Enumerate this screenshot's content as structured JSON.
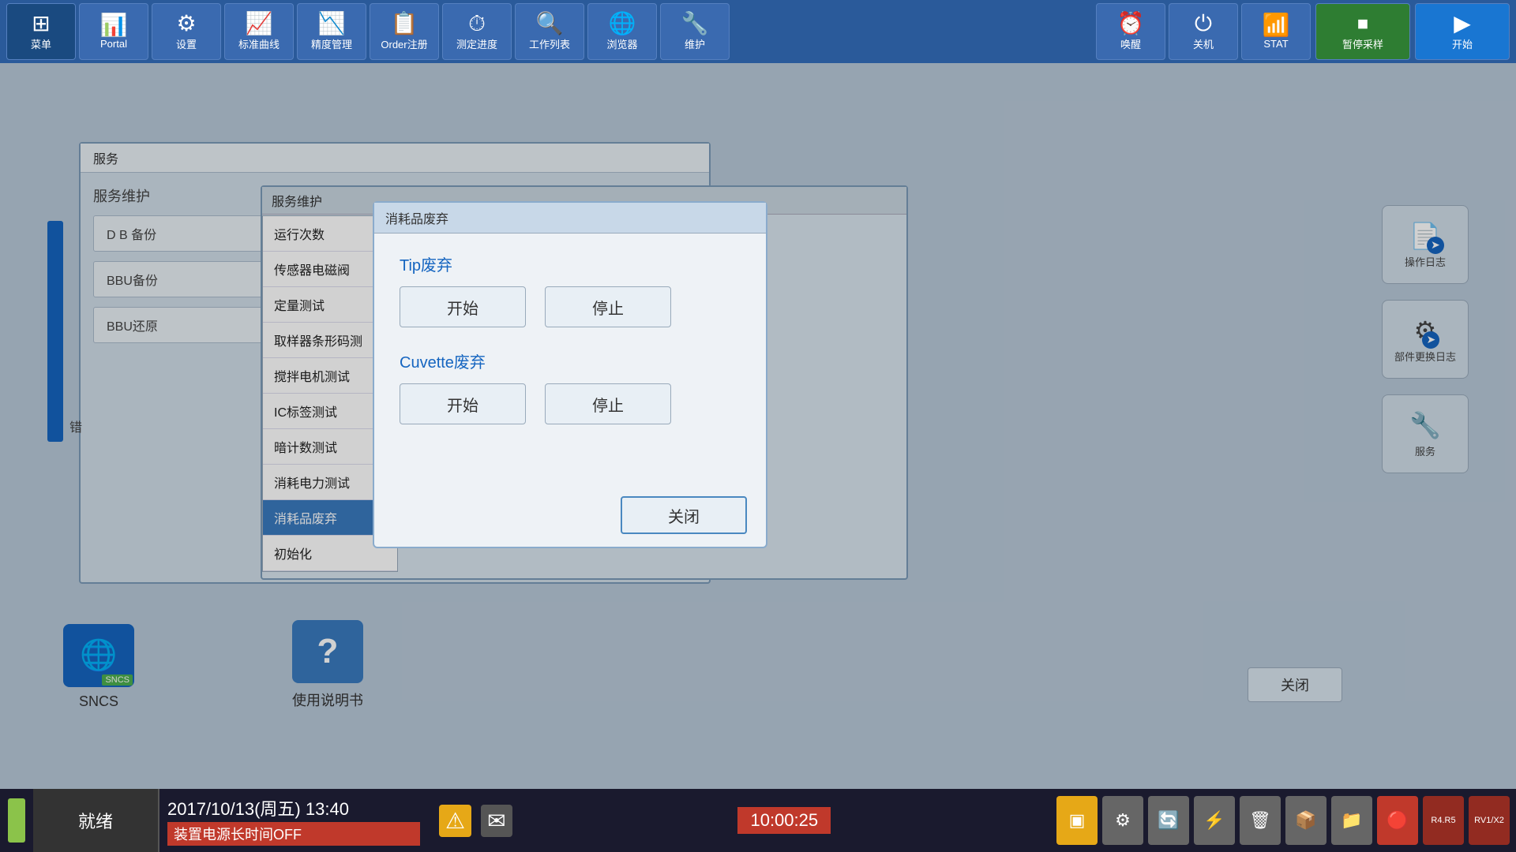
{
  "toolbar": {
    "title": "菜单",
    "buttons": [
      {
        "id": "menu",
        "label": "菜单",
        "icon": "⊞"
      },
      {
        "id": "portal",
        "label": "Portal",
        "icon": "📊"
      },
      {
        "id": "settings",
        "label": "设置",
        "icon": "⚙"
      },
      {
        "id": "standard-curve",
        "label": "标准曲线",
        "icon": "📈"
      },
      {
        "id": "precision-mgmt",
        "label": "精度管理",
        "icon": "📉"
      },
      {
        "id": "order-reg",
        "label": "Order注册",
        "icon": "📋"
      },
      {
        "id": "measure-progress",
        "label": "测定进度",
        "icon": "⏱"
      },
      {
        "id": "work-list",
        "label": "工作列表",
        "icon": "🔍"
      },
      {
        "id": "browser",
        "label": "浏览器",
        "icon": "🌐"
      },
      {
        "id": "maintenance",
        "label": "维护",
        "icon": "🔧"
      },
      {
        "id": "wakeup",
        "label": "唤醒",
        "icon": "⏰"
      },
      {
        "id": "shutdown",
        "label": "关机",
        "icon": "⏻"
      },
      {
        "id": "stat",
        "label": "STAT",
        "icon": "📶"
      },
      {
        "id": "pause",
        "label": "暂停采样",
        "icon": "⏹"
      },
      {
        "id": "start",
        "label": "开始",
        "icon": "▶"
      }
    ],
    "pause_label": "暂停采样",
    "start_label": "开始",
    "stat_label": "STAT"
  },
  "service_window": {
    "title": "服务",
    "subtitle": "服务维护",
    "rows": [
      {
        "label": "D B 备份"
      },
      {
        "label": "BBU备份"
      },
      {
        "label": "BBU还原"
      }
    ]
  },
  "service_panel": {
    "title": "服务维护"
  },
  "menu_items": [
    {
      "id": "run-count",
      "label": "运行次数"
    },
    {
      "id": "sensor-valve",
      "label": "传感器电磁阀"
    },
    {
      "id": "volume-test",
      "label": "定量测试"
    },
    {
      "id": "sampler-barcode",
      "label": "取样器条形码测"
    },
    {
      "id": "mixer-test",
      "label": "搅拌电机测试"
    },
    {
      "id": "ic-tag-test",
      "label": "IC标签测试"
    },
    {
      "id": "dark-count-test",
      "label": "暗计数测试"
    },
    {
      "id": "power-test",
      "label": "消耗电力测试"
    },
    {
      "id": "consumable-dispose",
      "label": "消耗品废弃",
      "selected": true
    },
    {
      "id": "initialize",
      "label": "初始化"
    }
  ],
  "consumable_dialog": {
    "title": "消耗品废弃",
    "tip_section_title": "Tip废弃",
    "tip_start_label": "开始",
    "tip_stop_label": "停止",
    "cuvette_section_title": "Cuvette废弃",
    "cuvette_start_label": "开始",
    "cuvette_stop_label": "停止",
    "close_label": "关闭"
  },
  "statusbar": {
    "ready_label": "就绪",
    "datetime": "2017/10/13(周五)  13:40",
    "message": "装置电源长时间OFF",
    "time_right": "10:00:25"
  },
  "bottom_icons": [
    {
      "id": "sncs",
      "label": "SNCS",
      "icon": "🌐",
      "badge": "SNCS"
    },
    {
      "id": "manual",
      "label": "使用说明书",
      "icon": "?"
    }
  ],
  "right_panel_icons": [
    {
      "id": "operation-log",
      "label": "操作日志",
      "icon": "📄"
    },
    {
      "id": "parts-log",
      "label": "部件更换日志",
      "icon": "⚙"
    },
    {
      "id": "service",
      "label": "服务",
      "icon": "🔧"
    }
  ],
  "status_icons": [
    {
      "id": "warn",
      "icon": "⚠",
      "color": "warn"
    },
    {
      "id": "mail",
      "icon": "✉",
      "color": "gray"
    }
  ],
  "bottom_right_icons": [
    {
      "id": "r1",
      "icon": "🔶",
      "color": "gold"
    },
    {
      "id": "r2",
      "icon": "⚙",
      "color": "gray"
    },
    {
      "id": "r3",
      "icon": "🔄",
      "color": "gray"
    },
    {
      "id": "r4",
      "icon": "⚡",
      "color": "gray"
    },
    {
      "id": "r5",
      "icon": "🗑",
      "color": "gray"
    },
    {
      "id": "r6",
      "icon": "📦",
      "color": "gray"
    },
    {
      "id": "r7",
      "icon": "📁",
      "color": "gray"
    },
    {
      "id": "r8",
      "icon": "🔴",
      "color": "red"
    },
    {
      "id": "r9",
      "label": "R4.R5",
      "color": "darkred"
    },
    {
      "id": "r10",
      "label": "RV1/X2",
      "color": "darkred"
    }
  ],
  "error_label": "错",
  "close_label": "关闭"
}
